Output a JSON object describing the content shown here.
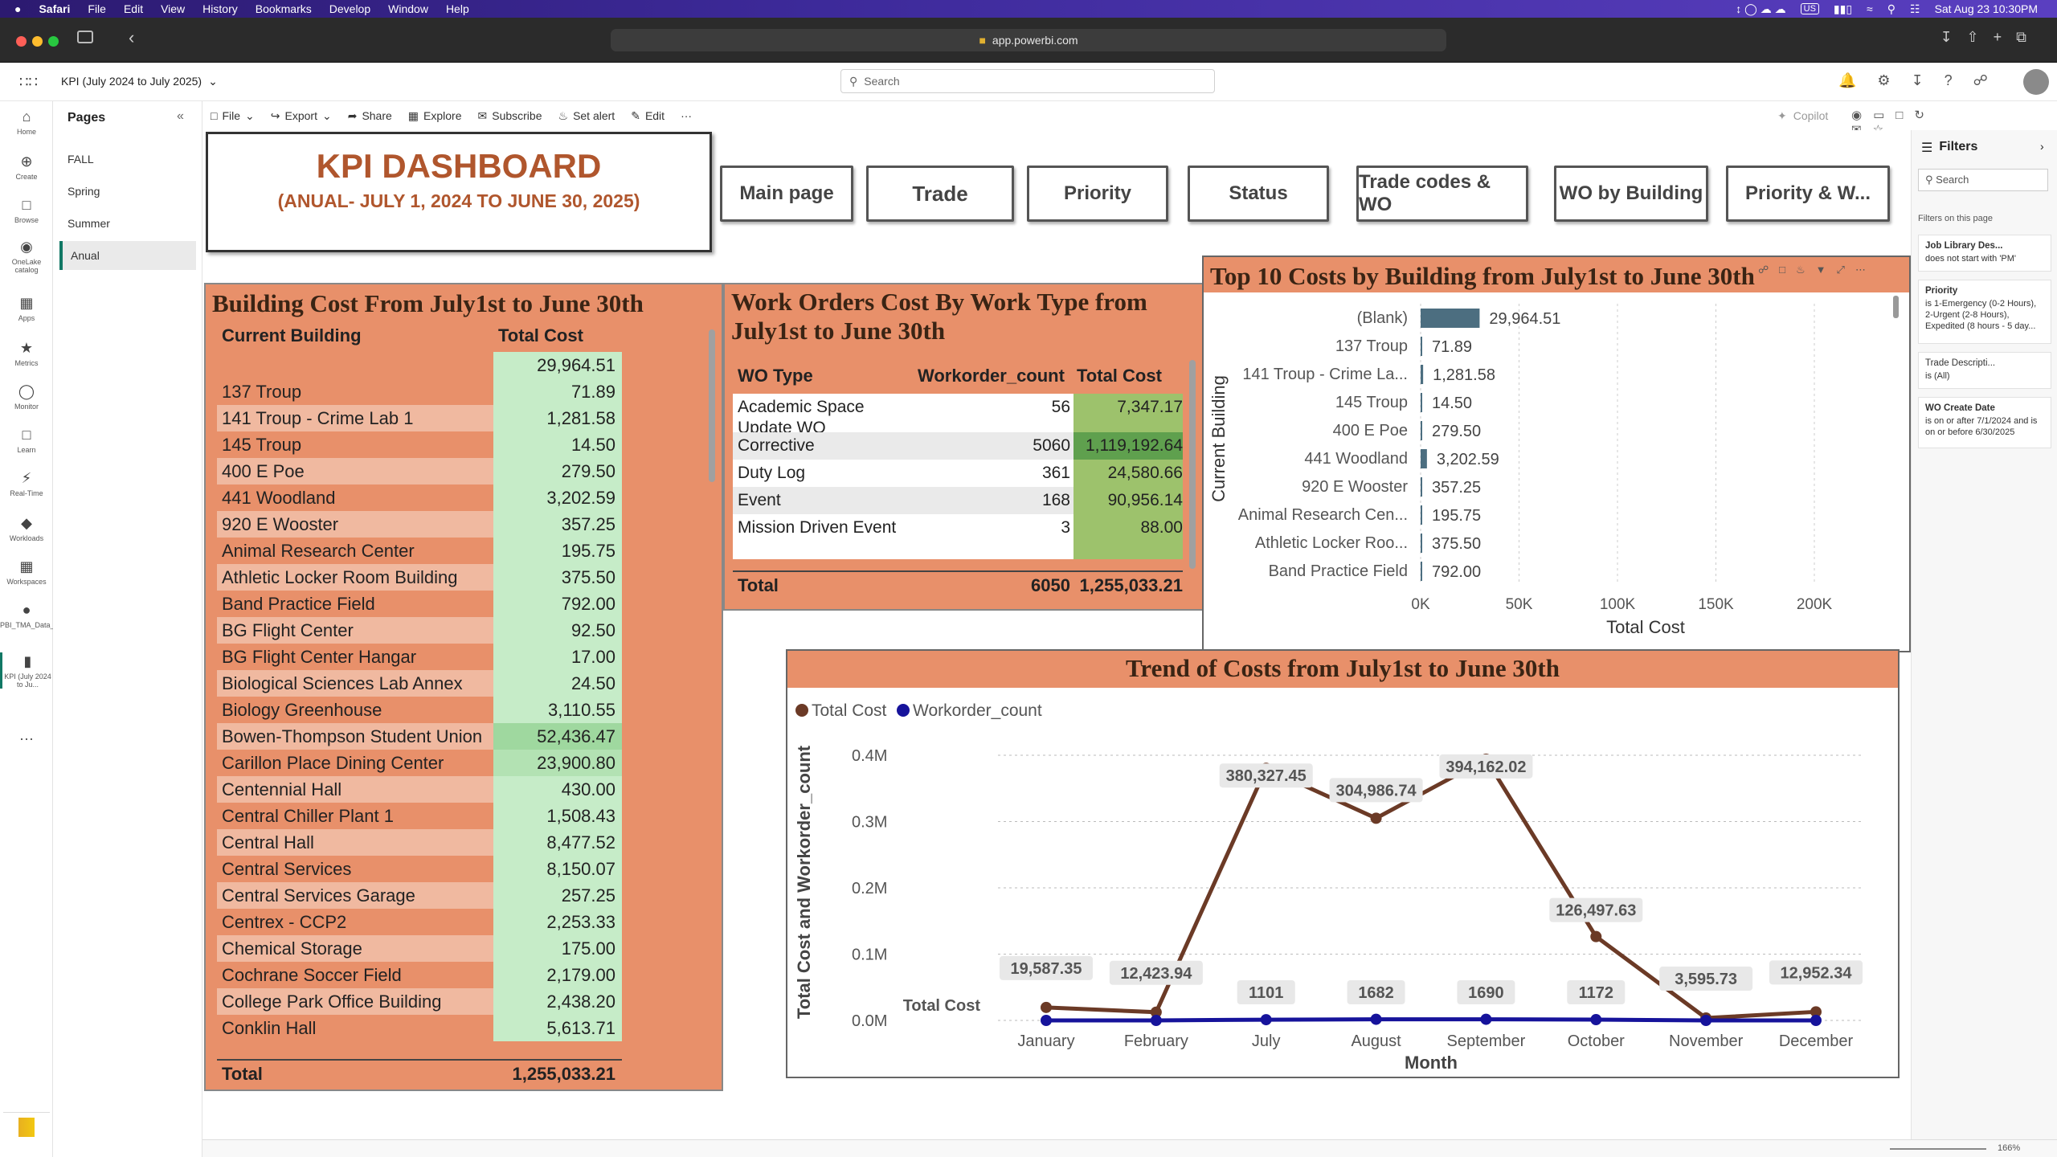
{
  "menubar": {
    "apple": "",
    "app": "Safari",
    "items": [
      "File",
      "Edit",
      "View",
      "History",
      "Bookmarks",
      "Develop",
      "Window",
      "Help"
    ],
    "input_lang": "US",
    "datetime": "Sat Aug 23  10:30PM"
  },
  "safari": {
    "url": "app.powerbi.com"
  },
  "header": {
    "report_title": "KPI (July 2024 to July 2025)",
    "search_placeholder": "Search"
  },
  "rail": [
    {
      "label": "Home",
      "icon": "home-icon"
    },
    {
      "label": "Create",
      "icon": "plus-icon"
    },
    {
      "label": "Browse",
      "icon": "folder-icon"
    },
    {
      "label": "OneLake catalog",
      "icon": "onelake-icon"
    },
    {
      "label": "Apps",
      "icon": "apps-icon"
    },
    {
      "label": "Metrics",
      "icon": "trophy-icon"
    },
    {
      "label": "Monitor",
      "icon": "monitor-icon"
    },
    {
      "label": "Learn",
      "icon": "book-icon"
    },
    {
      "label": "Real-Time",
      "icon": "lightning-icon"
    },
    {
      "label": "Workloads",
      "icon": "workloads-icon"
    },
    {
      "label": "Workspaces",
      "icon": "workspaces-icon"
    },
    {
      "label": "PBI_TMA_Data_Test",
      "icon": "dataset-icon"
    },
    {
      "label": "KPI (July 2024 to Ju...",
      "icon": "report-icon"
    },
    {
      "label": "...",
      "icon": "more-icon"
    }
  ],
  "pages": {
    "title": "Pages",
    "items": [
      "FALL",
      "Spring",
      "Summer",
      "Anual"
    ],
    "active": "Anual"
  },
  "toolbar": {
    "file": "File",
    "export": "Export",
    "share": "Share",
    "explore": "Explore",
    "subscribe": "Subscribe",
    "set_alert": "Set alert",
    "edit": "Edit",
    "more": "···",
    "copilot": "Copilot"
  },
  "dashboard": {
    "title": "KPI DASHBOARD",
    "subtitle": "(ANUAL- JULY 1, 2024 TO JUNE 30, 2025)"
  },
  "nav_buttons": [
    "Main page",
    "Trade",
    "Priority",
    "Status",
    "Trade codes & WO",
    "WO by Building",
    "Priority & W..."
  ],
  "building_table": {
    "title": "Building Cost From July1st to June 30th",
    "col1": "Current Building",
    "col2": "Total Cost",
    "rows": [
      [
        "",
        "29,964.51"
      ],
      [
        "137 Troup",
        "71.89"
      ],
      [
        "141 Troup - Crime Lab 1",
        "1,281.58"
      ],
      [
        "145 Troup",
        "14.50"
      ],
      [
        "400 E Poe",
        "279.50"
      ],
      [
        "441 Woodland",
        "3,202.59"
      ],
      [
        "920 E Wooster",
        "357.25"
      ],
      [
        "Animal Research Center",
        "195.75"
      ],
      [
        "Athletic Locker Room Building",
        "375.50"
      ],
      [
        "Band Practice Field",
        "792.00"
      ],
      [
        "BG Flight Center",
        "92.50"
      ],
      [
        "BG Flight Center Hangar",
        "17.00"
      ],
      [
        "Biological Sciences Lab Annex",
        "24.50"
      ],
      [
        "Biology Greenhouse",
        "3,110.55"
      ],
      [
        "Bowen-Thompson Student Union",
        "52,436.47"
      ],
      [
        "Carillon Place Dining Center",
        "23,900.80"
      ],
      [
        "Centennial Hall",
        "430.00"
      ],
      [
        "Central Chiller Plant 1",
        "1,508.43"
      ],
      [
        "Central Hall",
        "8,477.52"
      ],
      [
        "Central Services",
        "8,150.07"
      ],
      [
        "Central Services Garage",
        "257.25"
      ],
      [
        "Centrex - CCP2",
        "2,253.33"
      ],
      [
        "Chemical Storage",
        "175.00"
      ],
      [
        "Cochrane Soccer Field",
        "2,179.00"
      ],
      [
        "College Park Office Building",
        "2,438.20"
      ],
      [
        "Conklin Hall",
        "5,613.71"
      ]
    ],
    "total_label": "Total",
    "total_value": "1,255,033.21"
  },
  "wo_table": {
    "title": "Work Orders Cost By Work Type from July1st to June 30th",
    "col1": "WO Type",
    "col2": "Workorder_count",
    "col3": "Total Cost",
    "rows": [
      [
        "Academic Space Update WO",
        "56",
        "7,347.17"
      ],
      [
        "Corrective",
        "5060",
        "1,119,192.64"
      ],
      [
        "Duty Log",
        "361",
        "24,580.66"
      ],
      [
        "Event",
        "168",
        "90,956.14"
      ],
      [
        "Mission Driven Event",
        "3",
        "88.00"
      ]
    ],
    "total_label": "Total",
    "total_count": "6050",
    "total_cost": "1,255,033.21"
  },
  "filters": {
    "title": "Filters",
    "search_placeholder": "Search",
    "section": "Filters on this page",
    "cards": [
      {
        "name": "Job Library Des...",
        "value": "does not start with 'PM'"
      },
      {
        "name": "Priority",
        "value": "is 1-Emergency (0-2 Hours), 2-Urgent (2-8 Hours), Expedited (8 hours - 5 day..."
      },
      {
        "name": "Trade Descripti...",
        "value": "is (All)"
      },
      {
        "name": "WO Create Date",
        "value": "is on or after 7/1/2024 and is on or before 6/30/2025"
      }
    ]
  },
  "status": {
    "zoom": "166%"
  },
  "chart_data": [
    {
      "type": "bar",
      "orientation": "horizontal",
      "title": "Top 10 Costs by Building from July1st to June 30th",
      "xlabel": "Total Cost",
      "ylabel": "Current Building",
      "categories": [
        "(Blank)",
        "137 Troup",
        "141 Troup - Crime La...",
        "145 Troup",
        "400 E Poe",
        "441 Woodland",
        "920 E Wooster",
        "Animal Research Cen...",
        "Athletic Locker Roo...",
        "Band Practice Field"
      ],
      "values": [
        29964.51,
        71.89,
        1281.58,
        14.5,
        279.5,
        3202.59,
        357.25,
        195.75,
        375.5,
        792.0
      ],
      "value_labels": [
        "29,964.51",
        "71.89",
        "1,281.58",
        "14.50",
        "279.50",
        "3,202.59",
        "357.25",
        "195.75",
        "375.50",
        "792.00"
      ],
      "xlim": [
        0,
        240000
      ],
      "xticks": [
        "0K",
        "50K",
        "100K",
        "150K",
        "200K"
      ],
      "xtick_values": [
        0,
        50000,
        100000,
        150000,
        200000
      ],
      "bar_color": "#4c6e80",
      "grid": true
    },
    {
      "type": "line",
      "title": "Trend of Costs from July1st to June 30th",
      "xlabel": "Month",
      "ylabel": "Total Cost and Workorder_count",
      "categories": [
        "January",
        "February",
        "July",
        "August",
        "September",
        "October",
        "November",
        "December"
      ],
      "ylim": [
        0,
        400000
      ],
      "yticks": [
        "0.0M",
        "0.1M",
        "0.2M",
        "0.3M",
        "0.4M"
      ],
      "ytick_values": [
        0,
        100000,
        200000,
        300000,
        400000
      ],
      "series": [
        {
          "name": "Total Cost",
          "color": "#6b3a26",
          "values": [
            19587.35,
            12423.94,
            380327.45,
            304986.74,
            394162.02,
            126497.63,
            3595.73,
            12952.34
          ],
          "labels": [
            "19,587.35",
            "12,423.94",
            "380,327.45",
            "304,986.74",
            "394,162.02",
            "126,497.63",
            "3,595.73",
            "12,952.34"
          ]
        },
        {
          "name": "Workorder_count",
          "color": "#16139b",
          "values": [
            0,
            0,
            1101,
            1682,
            1690,
            1172,
            0,
            0
          ],
          "labels": [
            "",
            "",
            "1101",
            "1682",
            "1690",
            "1172",
            "",
            ""
          ]
        }
      ],
      "series_label": "Total Cost",
      "legend": "top-left",
      "grid": true
    }
  ]
}
